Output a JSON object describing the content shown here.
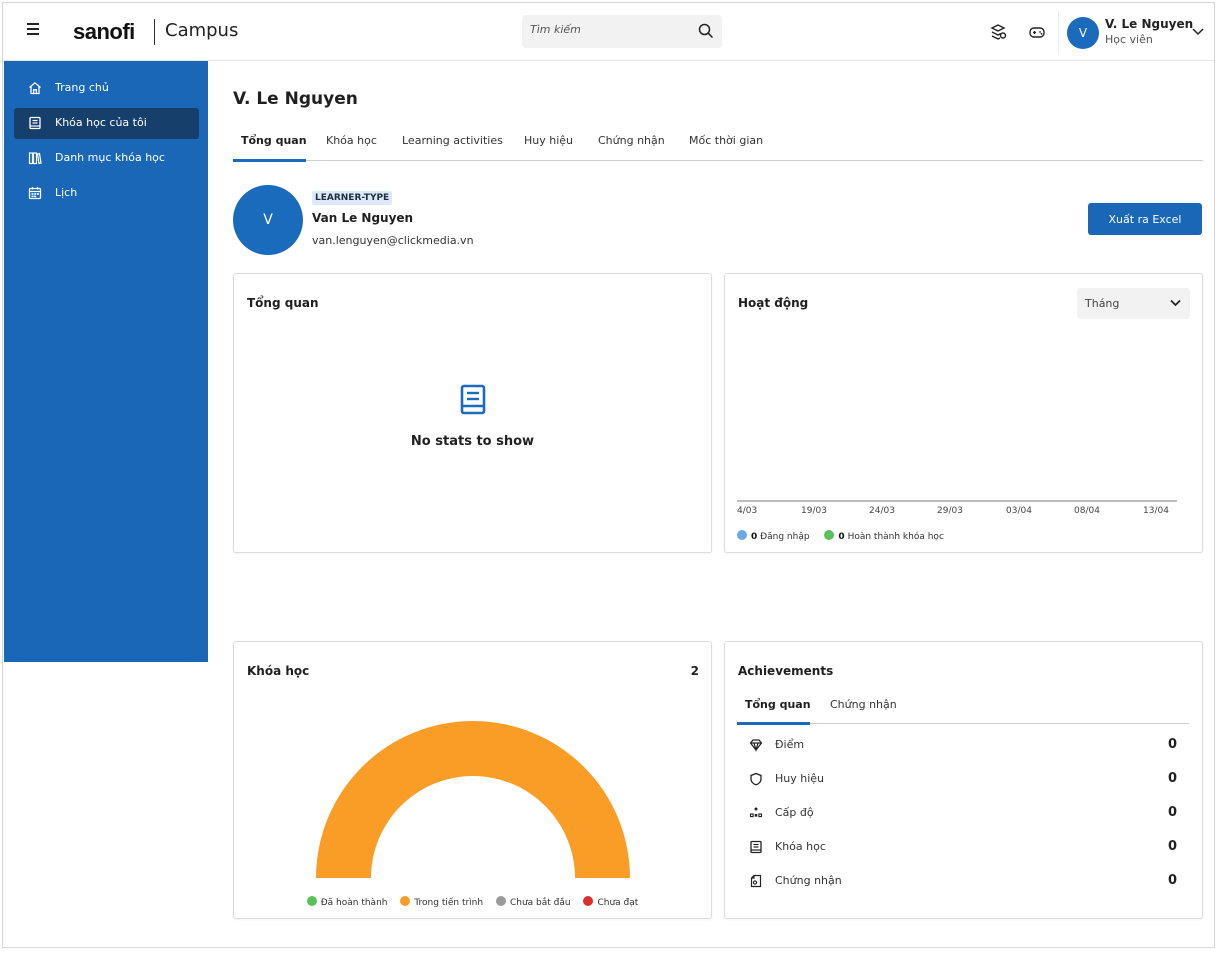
{
  "header": {
    "logo": "sanofi",
    "app_name": "Campus",
    "search_placeholder": "Tìm kiếm",
    "user": {
      "initial": "V",
      "name": "V. Le Nguyen",
      "role": "Học viên"
    }
  },
  "sidebar": {
    "items": [
      {
        "label": "Trang chủ",
        "icon": "home-icon",
        "active": false
      },
      {
        "label": "Khóa học của tôi",
        "icon": "book-icon",
        "active": true
      },
      {
        "label": "Danh mục khóa học",
        "icon": "library-icon",
        "active": false
      },
      {
        "label": "Lịch",
        "icon": "calendar-icon",
        "active": false
      }
    ]
  },
  "main": {
    "title": "V. Le Nguyen",
    "tabs": [
      {
        "label": "Tổng quan",
        "active": true
      },
      {
        "label": "Khóa học",
        "active": false
      },
      {
        "label": "Learning activities",
        "active": false
      },
      {
        "label": "Huy hiệu",
        "active": false
      },
      {
        "label": "Chứng nhận",
        "active": false
      },
      {
        "label": "Mốc thời gian",
        "active": false
      }
    ],
    "profile": {
      "initial": "V",
      "tag": "LEARNER-TYPE",
      "name": "Van Le Nguyen",
      "email": "van.lenguyen@clickmedia.vn"
    },
    "export_label": "Xuất ra Excel"
  },
  "overview_card": {
    "title": "Tổng quan",
    "empty_text": "No stats to show"
  },
  "activity_card": {
    "title": "Hoạt động",
    "period": "Tháng",
    "x_ticks": [
      "4/03",
      "19/03",
      "24/03",
      "29/03",
      "03/04",
      "08/04",
      "13/04"
    ],
    "legend": [
      {
        "count": "0",
        "label": "Đăng nhập",
        "color": "#6aa9e6"
      },
      {
        "count": "0",
        "label": "Hoàn thành khóa học",
        "color": "#5cbf5a"
      }
    ]
  },
  "courses_card": {
    "title": "Khóa học",
    "count": "2",
    "legend": [
      {
        "label": "Đã hoàn thành",
        "color": "#5cbf5a"
      },
      {
        "label": "Trong tiến trình",
        "color": "#f99d27"
      },
      {
        "label": "Chưa bắt đầu",
        "color": "#9a9a9a"
      },
      {
        "label": "Chưa đạt",
        "color": "#d93030"
      }
    ]
  },
  "chart_data": {
    "type": "pie",
    "title": "Khóa học",
    "categories": [
      "Đã hoàn thành",
      "Trong tiến trình",
      "Chưa bắt đầu",
      "Chưa đạt"
    ],
    "values": [
      0,
      2,
      0,
      0
    ],
    "colors": [
      "#5cbf5a",
      "#f99d27",
      "#9a9a9a",
      "#d93030"
    ],
    "style": "half-donut",
    "legend": "bottom"
  },
  "achievements_card": {
    "title": "Achievements",
    "tabs": [
      {
        "label": "Tổng quan",
        "active": true
      },
      {
        "label": "Chứng nhận",
        "active": false
      }
    ],
    "rows": [
      {
        "icon": "diamond-icon",
        "label": "Điểm",
        "value": "0"
      },
      {
        "icon": "shield-icon",
        "label": "Huy hiệu",
        "value": "0"
      },
      {
        "icon": "levels-icon",
        "label": "Cấp độ",
        "value": "0"
      },
      {
        "icon": "book-icon",
        "label": "Khóa học",
        "value": "0"
      },
      {
        "icon": "certificate-icon",
        "label": "Chứng nhận",
        "value": "0"
      }
    ]
  },
  "colors": {
    "brand": "#1b67b7",
    "sidebar_active": "#173f6c",
    "in_progress": "#f99d27"
  }
}
